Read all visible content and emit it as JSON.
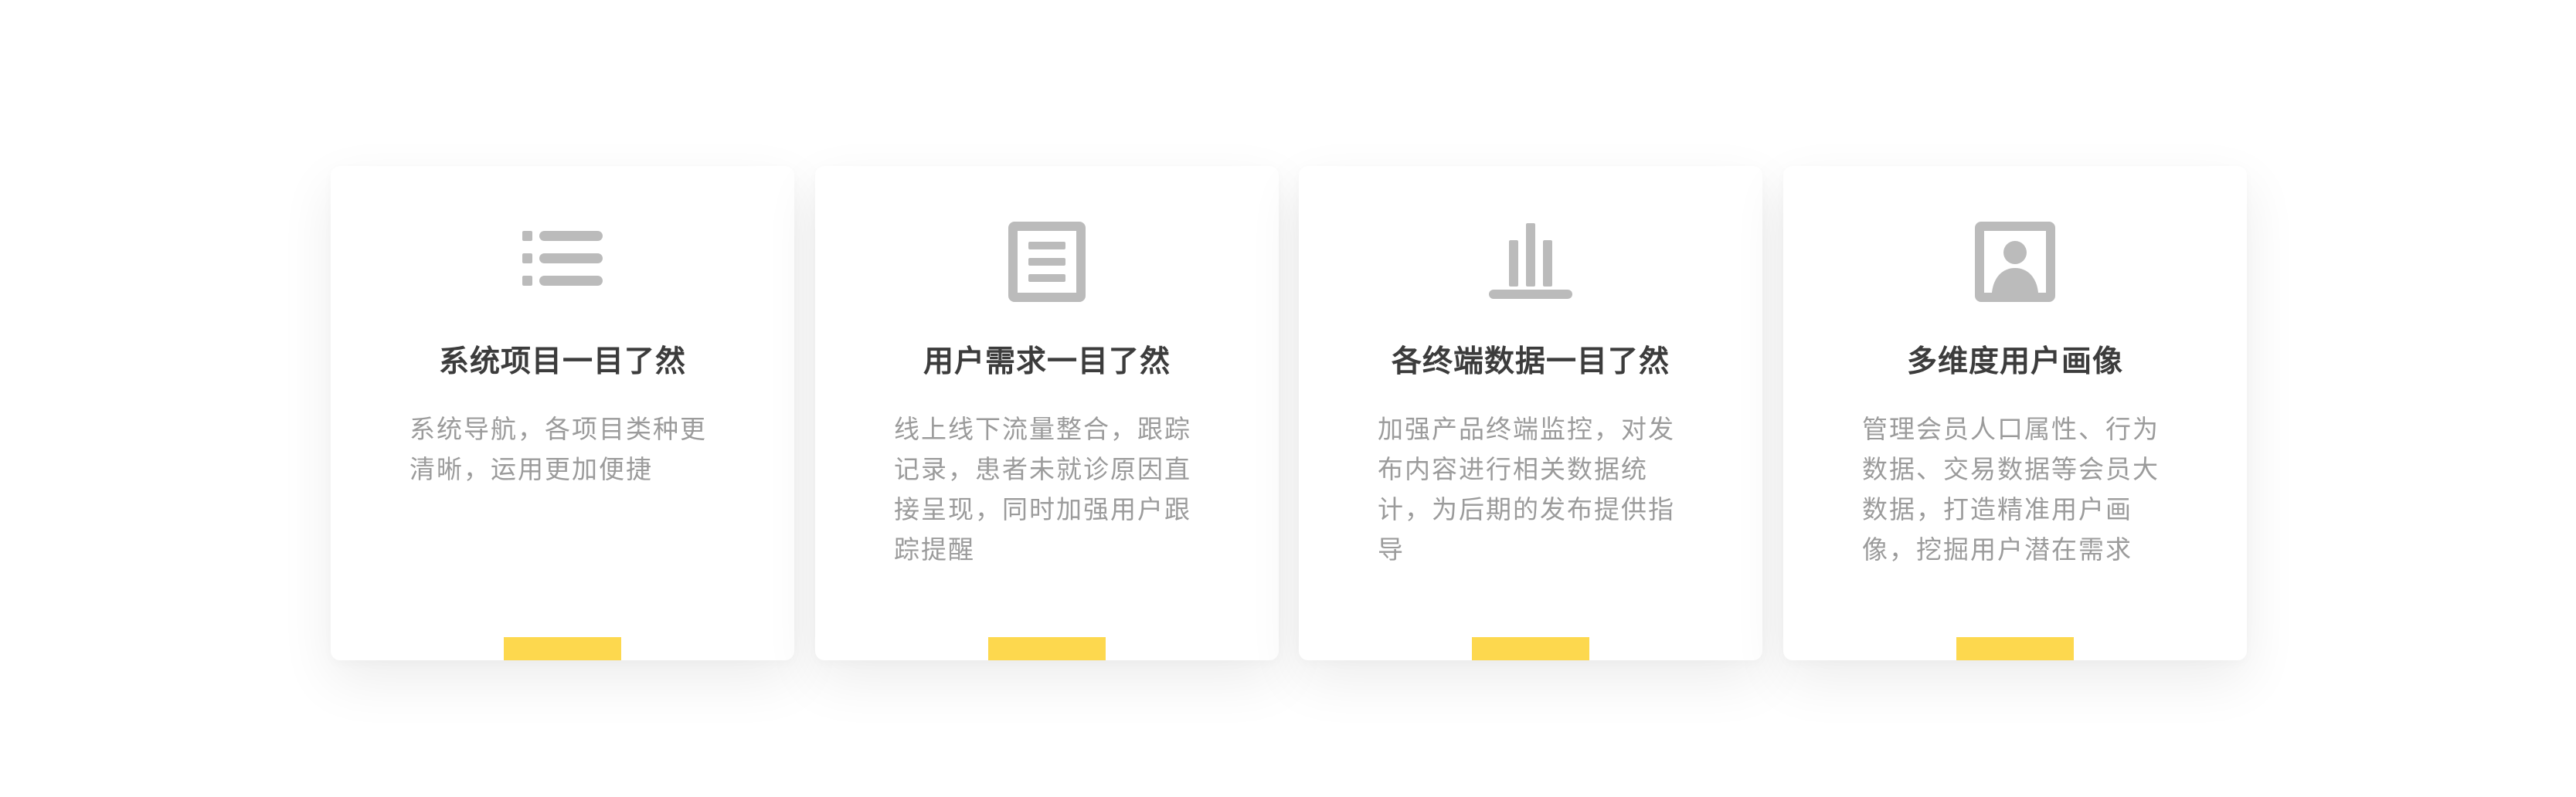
{
  "colors": {
    "accent": "#FDD84E",
    "icon": "#BBBBBB",
    "title": "#3C3C3C",
    "description": "#9B9B9B"
  },
  "cards": [
    {
      "icon": "list-icon",
      "title": "系统项目一目了然",
      "description": "系统导航，各项目类种更清晰，运用更加便捷"
    },
    {
      "icon": "document-icon",
      "title": "用户需求一目了然",
      "description": "线上线下流量整合，跟踪记录，患者未就诊原因直接呈现，同时加强用户跟踪提醒"
    },
    {
      "icon": "bar-chart-icon",
      "title": "各终端数据一目了然",
      "description": "加强产品终端监控，对发布内容进行相关数据统计，为后期的发布提供指导"
    },
    {
      "icon": "user-portrait-icon",
      "title": "多维度用户画像",
      "description": "管理会员人口属性、行为数据、交易数据等会员大数据，打造精准用户画像，挖掘用户潜在需求"
    }
  ]
}
